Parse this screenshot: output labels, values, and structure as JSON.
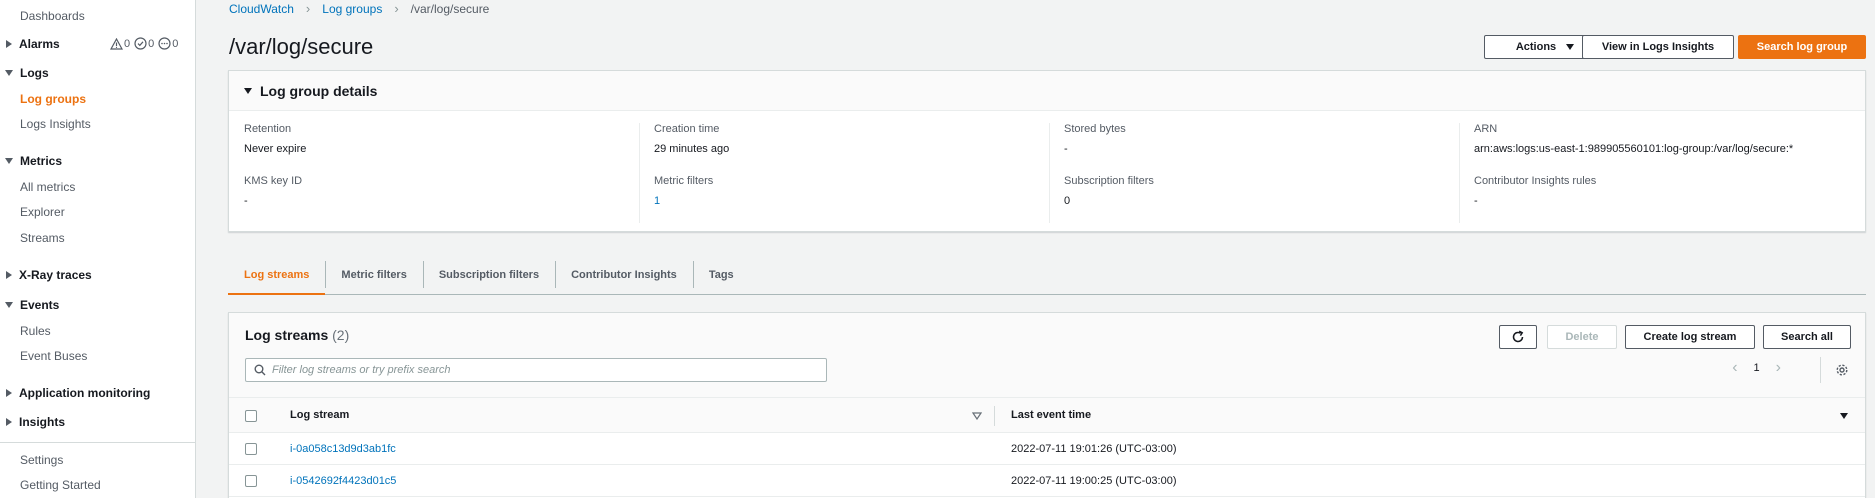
{
  "sidebar": {
    "dashboards": "Dashboards",
    "alarms": {
      "label": "Alarms",
      "in_alarm": "0",
      "ok": "0",
      "insufficient": "0"
    },
    "logs": {
      "label": "Logs",
      "log_groups": "Log groups",
      "logs_insights": "Logs Insights"
    },
    "metrics": {
      "label": "Metrics",
      "all_metrics": "All metrics",
      "explorer": "Explorer",
      "streams": "Streams"
    },
    "xray": "X-Ray traces",
    "events": {
      "label": "Events",
      "rules": "Rules",
      "event_buses": "Event Buses"
    },
    "application_monitoring": "Application monitoring",
    "insights": "Insights",
    "settings": "Settings",
    "getting_started": "Getting Started"
  },
  "breadcrumb": [
    "CloudWatch",
    "Log groups",
    "/var/log/secure"
  ],
  "page_title": "/var/log/secure",
  "header_buttons": {
    "actions": "Actions",
    "view_insights": "View in Logs Insights",
    "search_group": "Search log group"
  },
  "details": {
    "title": "Log group details",
    "fields": [
      {
        "label": "Retention",
        "value": "Never expire"
      },
      {
        "label": "Creation time",
        "value": "29 minutes ago"
      },
      {
        "label": "Stored bytes",
        "value": "-"
      },
      {
        "label": "ARN",
        "value": "arn:aws:logs:us-east-1:989905560101:log-group:/var/log/secure:*"
      },
      {
        "label": "KMS key ID",
        "value": "-"
      },
      {
        "label": "Metric filters",
        "value": "1"
      },
      {
        "label": "Subscription filters",
        "value": "0"
      },
      {
        "label": "Contributor Insights rules",
        "value": "-"
      }
    ]
  },
  "tabs": [
    "Log streams",
    "Metric filters",
    "Subscription filters",
    "Contributor Insights",
    "Tags"
  ],
  "streams": {
    "title": "Log streams",
    "count": "(2)",
    "buttons": {
      "delete": "Delete",
      "create": "Create log stream",
      "search_all": "Search all"
    },
    "filter_placeholder": "Filter log streams or try prefix search",
    "page": "1",
    "columns": [
      "Log stream",
      "Last event time"
    ],
    "rows": [
      {
        "name": "i-0a058c13d9d3ab1fc",
        "time": "2022-07-11 19:01:26 (UTC-03:00)"
      },
      {
        "name": "i-0542692f4423d01c5",
        "time": "2022-07-11 19:00:25 (UTC-03:00)"
      }
    ]
  },
  "colors": {
    "accent": "#ec7211",
    "link": "#0073bb",
    "text": "#16191f",
    "muted": "#545b64",
    "background": "#f2f3f3"
  }
}
